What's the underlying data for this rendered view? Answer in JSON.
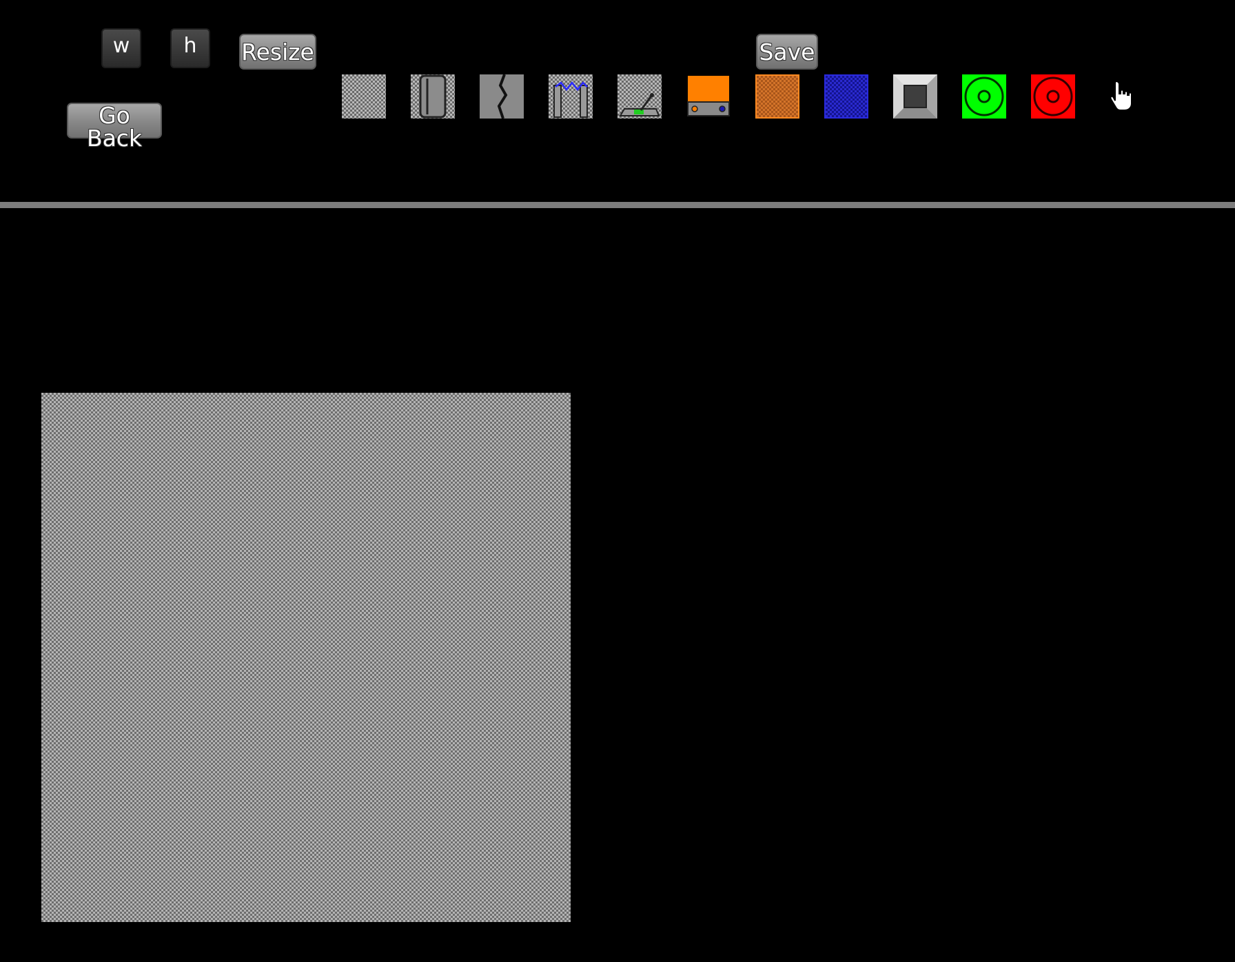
{
  "toolbar": {
    "width_placeholder": "w",
    "height_placeholder": "h",
    "resize_label": "Resize",
    "go_back_label": "Go Back",
    "save_label": "Save"
  },
  "palette": [
    {
      "name": "empty-floor-tile-icon"
    },
    {
      "name": "pillar-wall-tile-icon"
    },
    {
      "name": "cracked-wall-tile-icon"
    },
    {
      "name": "electric-fence-tile-icon"
    },
    {
      "name": "lever-switch-tile-icon"
    },
    {
      "name": "orange-crate-tile-icon",
      "color": "#ff8000"
    },
    {
      "name": "orange-mesh-tile-icon",
      "color": "#c2641a"
    },
    {
      "name": "blue-mesh-tile-icon",
      "color": "#1a1ab4"
    },
    {
      "name": "metal-block-tile-icon"
    },
    {
      "name": "green-target-tile-icon",
      "color": "#00ff00"
    },
    {
      "name": "red-target-tile-icon",
      "color": "#ff0000"
    }
  ],
  "colors": {
    "background": "#000000",
    "divider": "#7d7d7d",
    "button": "#8a8a8a"
  },
  "cursor": {
    "name": "hand-pointer-icon"
  }
}
